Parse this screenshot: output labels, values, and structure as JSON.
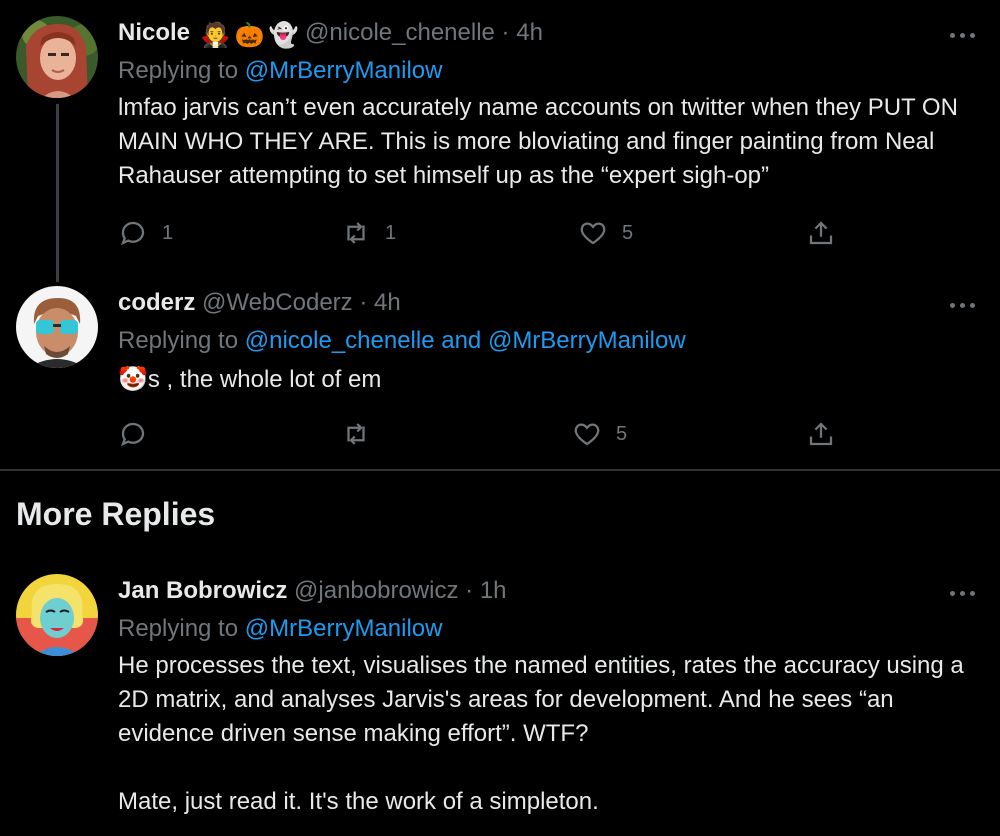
{
  "tweets": [
    {
      "name": "Nicole",
      "name_emojis": [
        "🧛",
        "🎃",
        "👻"
      ],
      "handle": "@nicole_chenelle",
      "sep": "·",
      "time": "4h",
      "replying_prefix": "Replying to",
      "replying_to": "@MrBerryManilow",
      "text": "lmfao jarvis can’t even accurately name accounts on twitter when they PUT ON MAIN WHO THEY ARE. This is more bloviating and finger painting from Neal Rahauser attempting to set himself up as the “expert sigh-op”",
      "reply_count": "1",
      "retweet_count": "1",
      "like_count": "5"
    },
    {
      "name": "coderz",
      "handle": "@WebCoderz",
      "sep": "·",
      "time": "4h",
      "replying_prefix": "Replying to",
      "replying_to": "@nicole_chenelle and @MrBerryManilow",
      "text_emoji": "🤡",
      "text": "s , the whole lot of em",
      "reply_count": "",
      "retweet_count": "",
      "like_count": "5"
    }
  ],
  "section_title": "More Replies",
  "more_replies": [
    {
      "name": "Jan Bobrowicz",
      "handle": "@janbobrowicz",
      "sep": "·",
      "time": "1h",
      "replying_prefix": "Replying to",
      "replying_to": "@MrBerryManilow",
      "text": "He processes the text, visualises the named entities, rates the accuracy using a 2D matrix, and analyses Jarvis's areas for development. And he sees “an evidence driven sense making effort”. WTF?",
      "text2": "Mate, just read it. It's the work of a simpleton."
    }
  ],
  "colors": {
    "background": "#000000",
    "text": "#e7e9ea",
    "secondary": "#71767b",
    "accent": "#1d9bf0"
  },
  "icons": [
    "reply-icon",
    "retweet-icon",
    "like-icon",
    "share-icon",
    "more-icon"
  ]
}
